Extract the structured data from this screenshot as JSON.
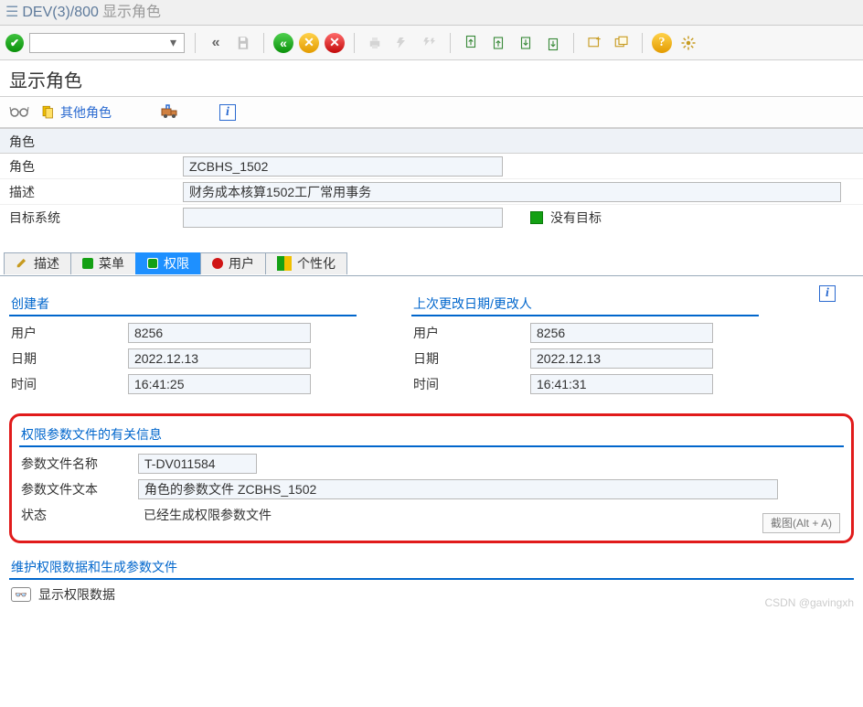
{
  "window": {
    "path": "DEV(3)/800",
    "title": "显示角色"
  },
  "toolbar": {
    "input_value": ""
  },
  "page_title": "显示角色",
  "subbar": {
    "other_roles": "其他角色"
  },
  "role_header": {
    "section": "角色",
    "role_label": "角色",
    "role_value": "ZCBHS_1502",
    "desc_label": "描述",
    "desc_value": "财务成本核算1502工厂常用事务",
    "target_label": "目标系统",
    "target_value": "",
    "no_target": "没有目标"
  },
  "tabs": {
    "t1": "描述",
    "t2": "菜单",
    "t3": "权限",
    "t4": "用户",
    "t5": "个性化"
  },
  "creator": {
    "head": "创建者",
    "user_l": "用户",
    "user_v": "8256",
    "date_l": "日期",
    "date_v": "2022.12.13",
    "time_l": "时间",
    "time_v": "16:41:25"
  },
  "changer": {
    "head": "上次更改日期/更改人",
    "user_l": "用户",
    "user_v": "8256",
    "date_l": "日期",
    "date_v": "2022.12.13",
    "time_l": "时间",
    "time_v": "16:41:31"
  },
  "param": {
    "head": "权限参数文件的有关信息",
    "name_l": "参数文件名称",
    "name_v": "T-DV011584",
    "text_l": "参数文件文本",
    "text_v": "角色的参数文件 ZCBHS_1502",
    "status_l": "状态",
    "status_v": "已经生成权限参数文件"
  },
  "snip": "截图(Alt + A)",
  "maint": {
    "head": "维护权限数据和生成参数文件",
    "btn": "显示权限数据"
  },
  "watermark": "CSDN @gavingxh"
}
